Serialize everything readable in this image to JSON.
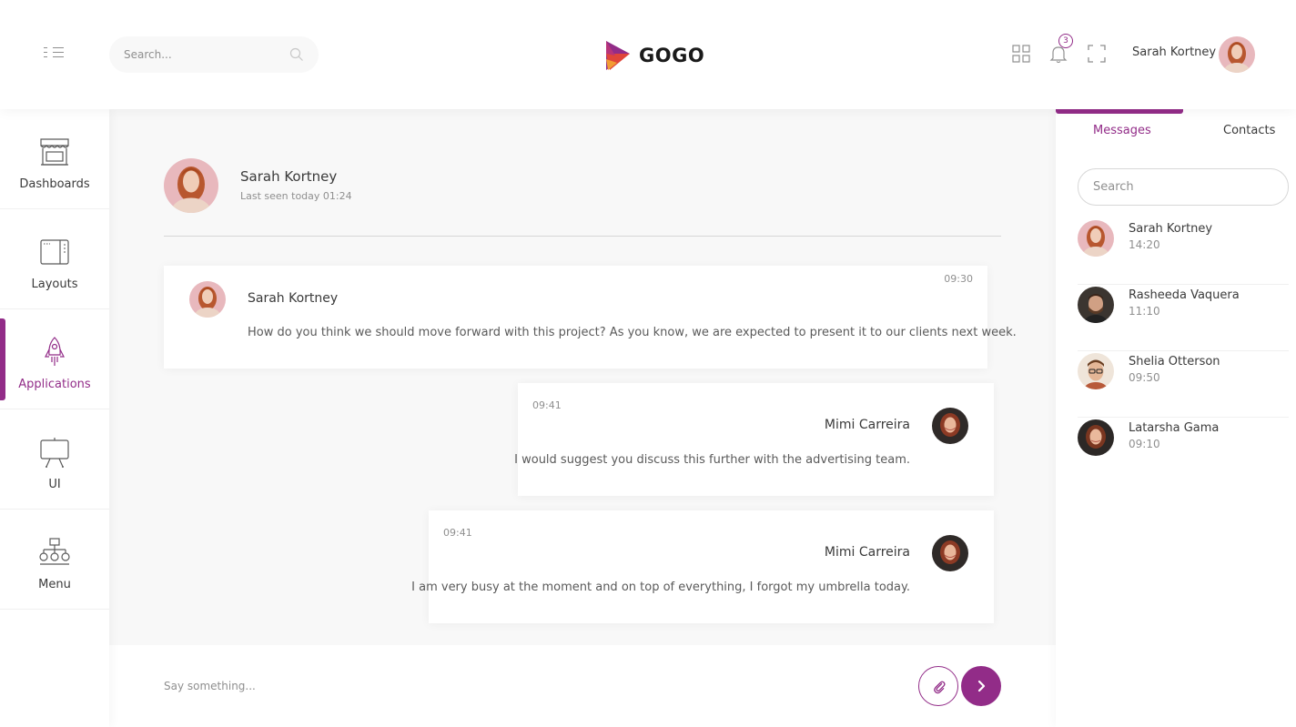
{
  "header": {
    "search_placeholder": "Search...",
    "logo_text": "GOGO",
    "notification_count": "3",
    "user_name": "Sarah Kortney"
  },
  "sidebar": {
    "items": [
      {
        "label": "Dashboards",
        "icon": "shop-icon"
      },
      {
        "label": "Layouts",
        "icon": "layout-icon"
      },
      {
        "label": "Applications",
        "icon": "rocket-icon",
        "active": true
      },
      {
        "label": "UI",
        "icon": "easel-icon"
      },
      {
        "label": "Menu",
        "icon": "sitemap-icon"
      }
    ]
  },
  "chat": {
    "partner_name": "Sarah Kortney",
    "last_seen": "Last seen today 01:24",
    "messages": [
      {
        "sender": "Sarah Kortney",
        "time": "09:30",
        "text": "How do you think we should move forward with this project? As you know, we are expected to present it to our clients next week."
      },
      {
        "sender": "Mimi Carreira",
        "time": "09:41",
        "text": "I would suggest you discuss this further with the advertising team."
      },
      {
        "sender": "Mimi Carreira",
        "time": "09:41",
        "text": "I am very busy at the moment and on top of everything, I forgot my umbrella today."
      }
    ],
    "composer_placeholder": "Say something..."
  },
  "right_panel": {
    "tabs": [
      {
        "label": "Messages",
        "active": true
      },
      {
        "label": "Contacts",
        "active": false
      }
    ],
    "search_placeholder": "Search",
    "contacts": [
      {
        "name": "Sarah Kortney",
        "time": "14:20"
      },
      {
        "name": "Rasheeda Vaquera",
        "time": "11:10"
      },
      {
        "name": "Shelia Otterson",
        "time": "09:50"
      },
      {
        "name": "Latarsha Gama",
        "time": "09:10"
      }
    ]
  },
  "colors": {
    "accent": "#922c88",
    "background": "#f8f8f8",
    "text": "#3a3a3a",
    "muted_text": "#8f8f8f"
  }
}
